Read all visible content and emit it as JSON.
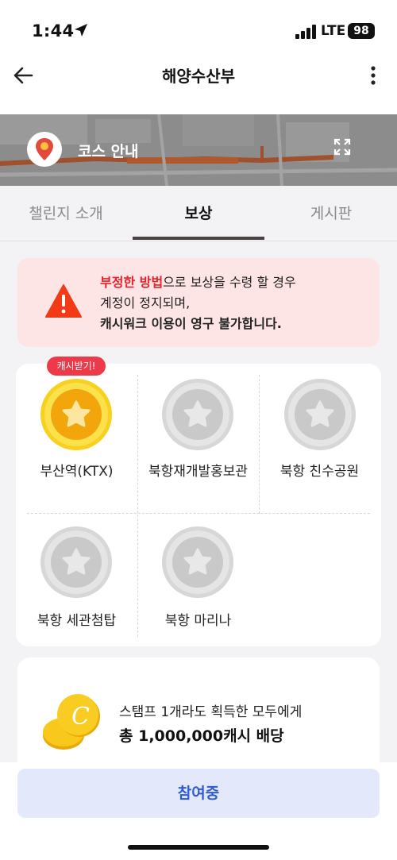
{
  "status_bar": {
    "time": "1:44",
    "network": "LTE",
    "battery": "98"
  },
  "nav": {
    "title": "해양수산부",
    "back_icon": "arrow-left-icon",
    "more_icon": "more-vertical-icon"
  },
  "map": {
    "title": "코스 안내"
  },
  "tabs": [
    {
      "label": "챌린지 소개",
      "active": false
    },
    {
      "label": "보상",
      "active": true
    },
    {
      "label": "게시판",
      "active": false
    }
  ],
  "warning": {
    "highlight": "부정한 방법",
    "line1_rest": "으로 보상을 수령 할 경우",
    "line2": "계정이 정지되며,",
    "line3": "캐시워크 이용이 영구 불가합니다."
  },
  "stamps": {
    "badge": "캐시받기!",
    "items": [
      {
        "label": "부산역(KTX)",
        "achieved": true
      },
      {
        "label": "북항재개발홍보관",
        "achieved": false
      },
      {
        "label": "북항 친수공원",
        "achieved": false
      },
      {
        "label": "북항 세관첨탑",
        "achieved": false
      },
      {
        "label": "북항 마리나",
        "achieved": false
      }
    ]
  },
  "reward": {
    "line1": "스탬프 1개라도 획득한 모두에게",
    "line2": "총 1,000,000캐시 배당"
  },
  "join_button": "참여중",
  "colors": {
    "accent_blue": "#2e5bd3",
    "warning_red": "#e8202a",
    "badge_red": "#ec3a4a",
    "gold": "#f5b400"
  }
}
